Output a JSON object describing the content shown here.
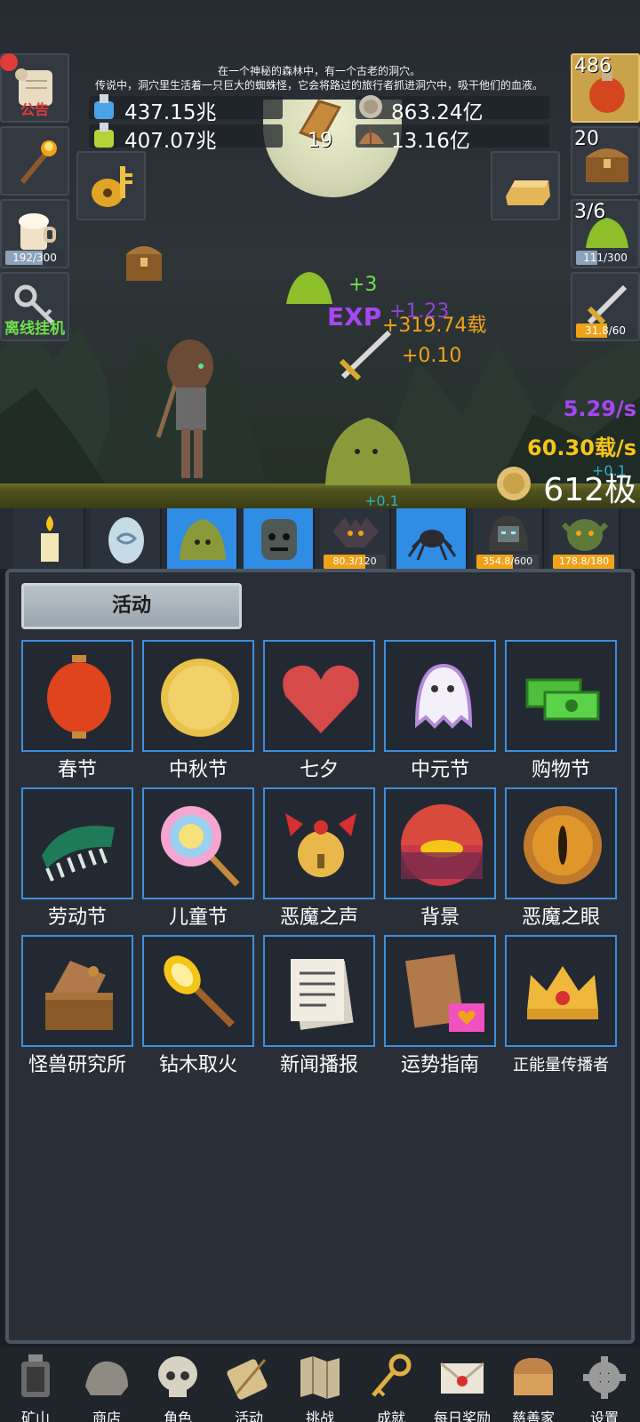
{
  "left_slots": {
    "notice_label": "公告",
    "milk_progress": "192/300",
    "milk_fill": 0.64,
    "offline_label": "离线挂机"
  },
  "story_text": {
    "line1": "在一个神秘的森林中，有一个古老的洞穴。",
    "line2": "传说中，洞穴里生活着一只巨大的蜘蛛怪，它会将路过的旅行者抓进洞穴中，吸干他们的血液。"
  },
  "resources": {
    "blue_potion": "437.15兆",
    "green_potion": "407.07兆",
    "book_count": "19",
    "silver_coin": "863.24亿",
    "shell": "13.16亿"
  },
  "right_slots": {
    "potion_count": "486",
    "chest_count": "20",
    "slime_count": "3/6",
    "slime_progress": "111/300",
    "slime_fill": 0.37,
    "sword_progress": "31.8/60",
    "sword_fill": 0.53
  },
  "battle": {
    "float_plus3": "+3",
    "float_exp": "EXP",
    "float_exp_value": "+319.74载",
    "float_purple": "+1.23",
    "float_plus010": "+0.10",
    "float_plus01a": "+0.1",
    "float_plus01b": "+0.1",
    "rate_purple": "5.29/s",
    "rate_gold": "60.30载/s",
    "level": "612极"
  },
  "monsters": [
    {
      "name": "candle",
      "hp": ""
    },
    {
      "name": "egg",
      "hp": ""
    },
    {
      "name": "slime",
      "hp": ""
    },
    {
      "name": "zombie",
      "hp": ""
    },
    {
      "name": "bat",
      "hp": "80.3/120",
      "fill": 0.67
    },
    {
      "name": "spider",
      "hp": ""
    },
    {
      "name": "ghost",
      "hp": "354.8/600",
      "fill": 0.59
    },
    {
      "name": "orc",
      "hp": "178.8/180",
      "fill": 0.99
    }
  ],
  "panel": {
    "title": "活动",
    "items": [
      "春节",
      "中秋节",
      "七夕",
      "中元节",
      "购物节",
      "劳动节",
      "儿童节",
      "恶魔之声",
      "背景",
      "恶魔之眼",
      "怪兽研究所",
      "钻木取火",
      "新闻播报",
      "运势指南",
      "正能量传播者"
    ]
  },
  "nav": [
    "矿山",
    "商店",
    "角色",
    "活动",
    "挑战",
    "成就",
    "每日奖励",
    "慈善家",
    "设置"
  ],
  "colors": {
    "accent_blue": "#2f8de4",
    "tile_border": "#3d8fdc",
    "green_text": "#6fe04c",
    "purple_text": "#a646f2",
    "gold_text": "#f5c518",
    "orange_text": "#f0a21a"
  }
}
